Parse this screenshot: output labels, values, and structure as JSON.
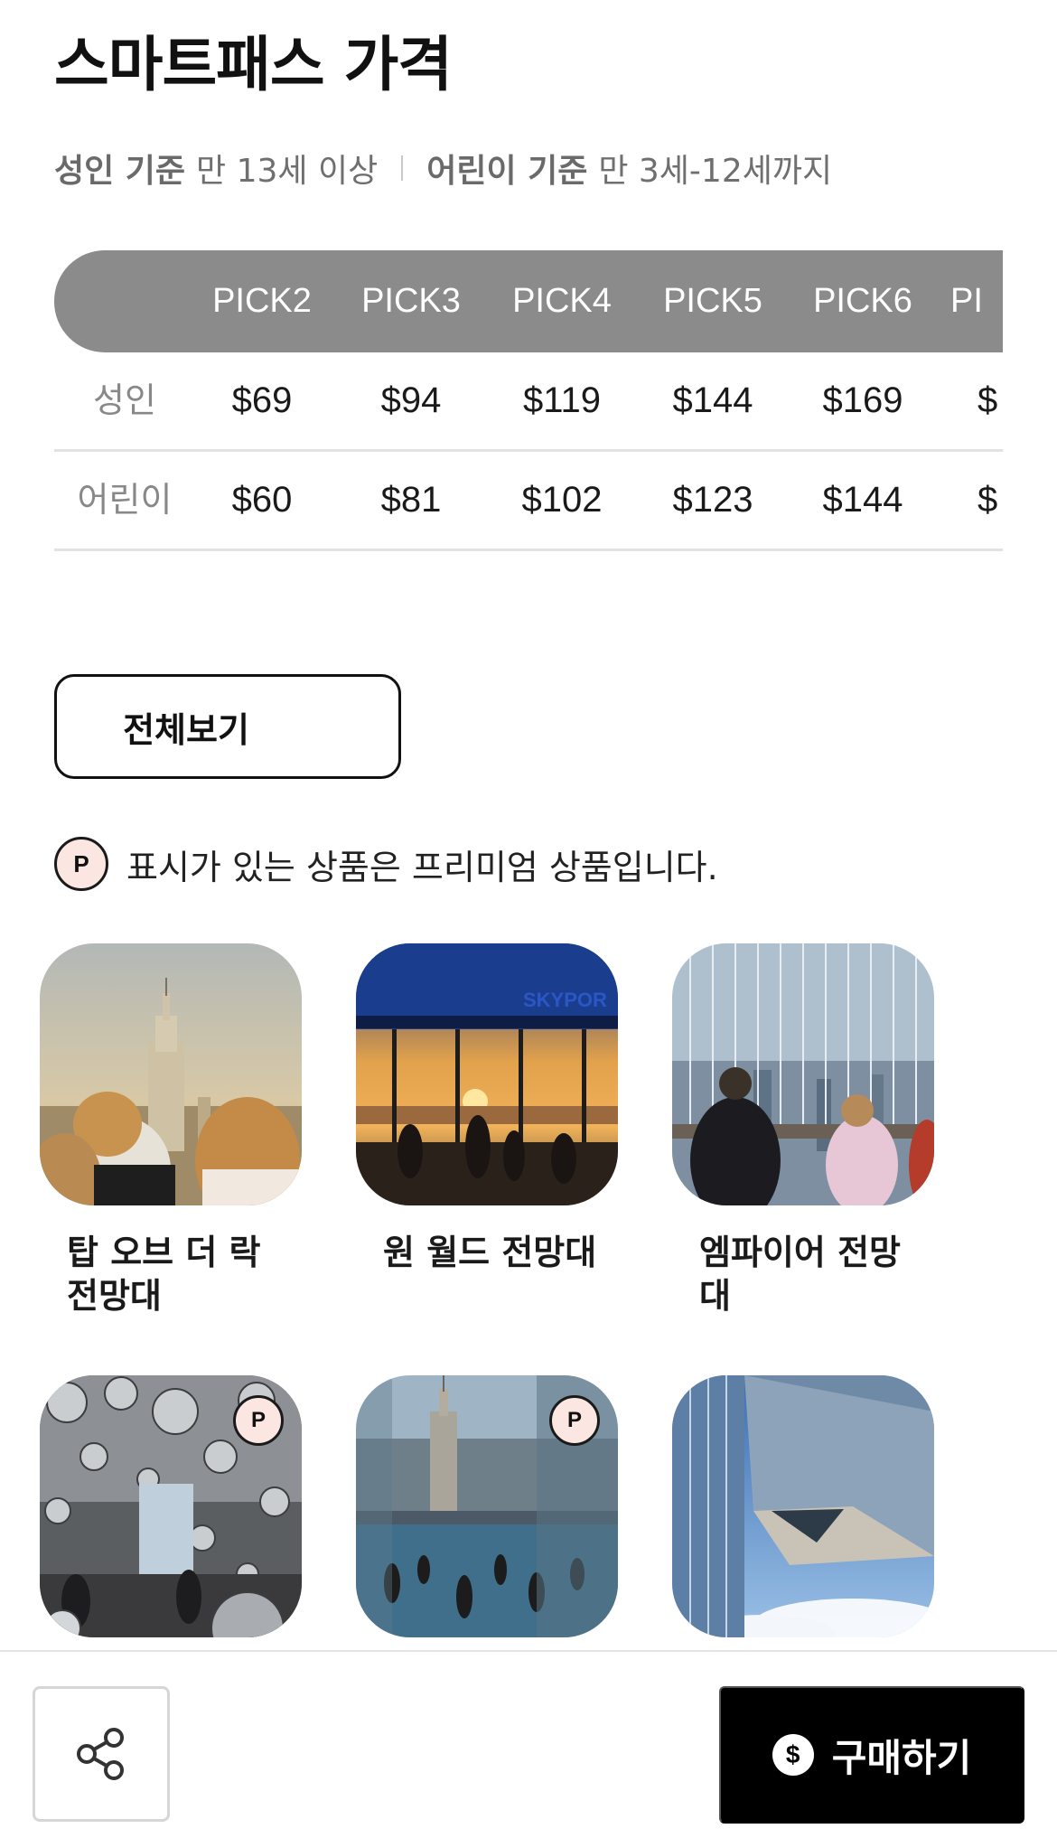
{
  "title": "스마트패스 가격",
  "age_info": {
    "adult_label": "성인 기준",
    "adult_value": "만 13세 이상",
    "child_label": "어린이 기준",
    "child_value": "만 3세-12세까지"
  },
  "price_table": {
    "headers": [
      "PICK2",
      "PICK3",
      "PICK4",
      "PICK5",
      "PICK6",
      "PI"
    ],
    "rows": [
      {
        "label": "성인",
        "prices": [
          "$69",
          "$94",
          "$119",
          "$144",
          "$169",
          "$"
        ]
      },
      {
        "label": "어린이",
        "prices": [
          "$60",
          "$81",
          "$102",
          "$123",
          "$144",
          "$"
        ]
      }
    ]
  },
  "view_all_label": "전체보기",
  "premium_note": {
    "badge": "P",
    "text": "표시가 있는 상품은 프리미엄 상품입니다."
  },
  "cards": [
    {
      "title": "탑 오브 더 락 전망대",
      "premium": false
    },
    {
      "title": "원 월드 전망대",
      "premium": false
    },
    {
      "title": "엠파이어 전망대",
      "premium": false
    },
    {
      "title": "",
      "premium": true,
      "badge": "P"
    },
    {
      "title": "",
      "premium": true,
      "badge": "P"
    },
    {
      "title": "",
      "premium": false
    }
  ],
  "bottom_bar": {
    "buy_label": "구매하기",
    "buy_icon": "$",
    "share_icon": "share-icon"
  }
}
